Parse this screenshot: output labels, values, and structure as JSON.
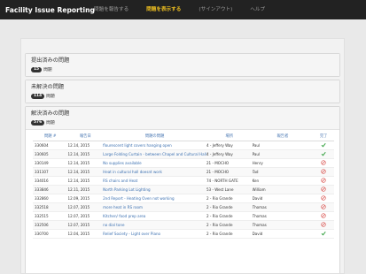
{
  "nav": {
    "brand": "Facility Issue Reporting",
    "items": [
      {
        "label": "問題を報告する",
        "active": false
      },
      {
        "label": "問題を表示する",
        "active": true
      },
      {
        "label": "(サインアウト)",
        "active": false
      },
      {
        "label": "ヘルプ",
        "active": false
      }
    ]
  },
  "sections": {
    "submitted": {
      "title": "提出済みの問題",
      "count": "15",
      "count_label": "問題"
    },
    "unresolved": {
      "title": "未解決の問題",
      "count": "114",
      "count_label": "問題"
    },
    "resolved": {
      "title": "解決済みの問題",
      "count": "576",
      "count_label": "問題"
    }
  },
  "table": {
    "headers": [
      "問題 #",
      "報告日",
      "問題の問題",
      "場所",
      "報告者",
      "完了"
    ],
    "rows": [
      {
        "id": "330604",
        "date": "12.14, 2015",
        "title": "flourescent light covers hanging open",
        "location": "4 - Jeffery Way",
        "reporter": "Paul",
        "status": "check"
      },
      {
        "id": "330605",
        "date": "12.14, 2015",
        "title": "Large Folding Curtain - between Chapel and Cultural Hall",
        "location": "4 - Jeffery Way",
        "reporter": "Paul",
        "status": "check"
      },
      {
        "id": "330149",
        "date": "12.14, 2015",
        "title": "No supplies available",
        "location": "21 - MOCHO",
        "reporter": "Henry",
        "status": "no"
      },
      {
        "id": "331107",
        "date": "12.14, 2015",
        "title": "Heat in cultural hall doesnt work",
        "location": "21 - MOCHO",
        "reporter": "Tad",
        "status": "no"
      },
      {
        "id": "334016",
        "date": "12.14, 2015",
        "title": "RS chairs and Heat",
        "location": "74 - NORTH GATE",
        "reporter": "Ken",
        "status": "no"
      },
      {
        "id": "333846",
        "date": "12.11, 2015",
        "title": "North Parking Lot Lighting",
        "location": "53 - West Lane",
        "reporter": "William",
        "status": "no"
      },
      {
        "id": "332860",
        "date": "12.09, 2015",
        "title": "2nd Report - Heating Oven not working",
        "location": "2 - Rio Grande",
        "reporter": "David",
        "status": "no"
      },
      {
        "id": "332518",
        "date": "12.07, 2015",
        "title": "more heat in RS room",
        "location": "2 - Rio Grande",
        "reporter": "Thomas",
        "status": "no"
      },
      {
        "id": "332515",
        "date": "12.07, 2015",
        "title": "Kitchen/ food prep area",
        "location": "2 - Rio Grande",
        "reporter": "Thomas",
        "status": "no"
      },
      {
        "id": "332506",
        "date": "12.07, 2015",
        "title": "no dial tone",
        "location": "2 - Rio Grande",
        "reporter": "Thomas",
        "status": "no"
      },
      {
        "id": "330700",
        "date": "12.04, 2015",
        "title": "Relief Society - Light over Piano",
        "location": "2 - Rio Grande",
        "reporter": "David",
        "status": "check"
      }
    ]
  },
  "colors": {
    "check": "#2e9e3a",
    "no": "#d9534f",
    "link": "#3a6fb0",
    "nav_active": "#f0c020"
  }
}
